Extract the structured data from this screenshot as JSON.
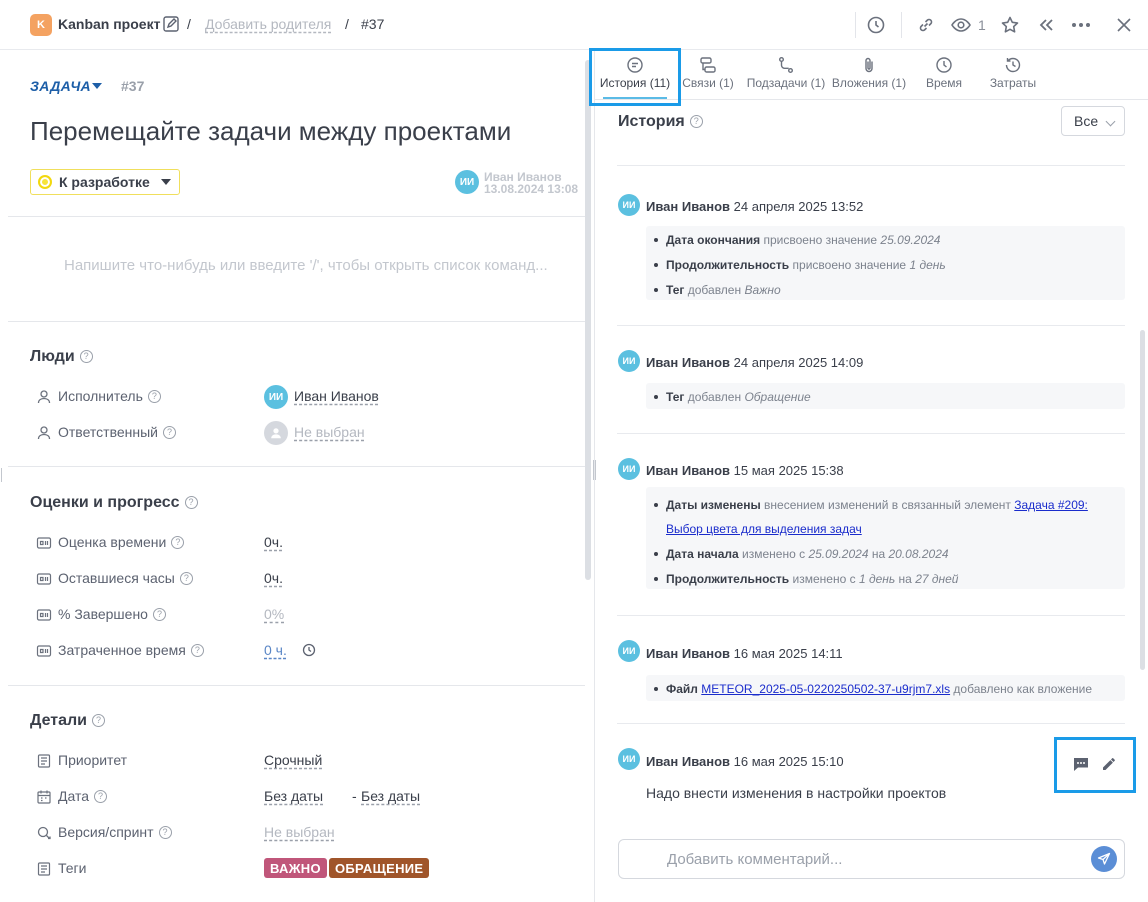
{
  "header": {
    "project_initial": "K",
    "project_name": "Kanban проект",
    "separator": "/",
    "add_parent": "Добавить родителя",
    "task_number": "#37",
    "watchers_count": "1"
  },
  "task": {
    "type": "ЗАДАЧА",
    "number": "#37",
    "title": "Перемещайте задачи между проектами",
    "status": "К разработке",
    "author_initials": "ИИ",
    "author_name": "Иван Иванов",
    "author_date": "13.08.2024 13:08",
    "description_placeholder": "Напишите что-нибудь или введите '/', чтобы открыть список команд..."
  },
  "people": {
    "title": "Люди",
    "assignee_label": "Исполнитель",
    "assignee_initials": "ИИ",
    "assignee_value": "Иван Иванов",
    "responsible_label": "Ответственный",
    "responsible_value": "Не выбран"
  },
  "estimates": {
    "title": "Оценки и прогресс",
    "rows": [
      {
        "label": "Оценка времени",
        "value": "0ч."
      },
      {
        "label": "Оставшиеся часы",
        "value": "0ч."
      },
      {
        "label": "% Завершено",
        "value": "0%"
      },
      {
        "label": "Затраченное время",
        "value": "0 ч."
      }
    ]
  },
  "details": {
    "title": "Детали",
    "priority_label": "Приоритет",
    "priority_value": "Срочный",
    "date_label": "Дата",
    "date_start": "Без даты",
    "date_sep": "-",
    "date_end": "Без даты",
    "version_label": "Версия/спринт",
    "version_value": "Не выбран",
    "tags_label": "Теги",
    "tags": [
      {
        "label": "ВАЖНО",
        "color": "#c0567a"
      },
      {
        "label": "ОБРАЩЕНИЕ",
        "color": "#a0552a"
      }
    ]
  },
  "tabs": [
    {
      "label": "История (11)",
      "icon": "comment-icon"
    },
    {
      "label": "Связи (1)",
      "icon": "links-icon"
    },
    {
      "label": "Подзадачи (1)",
      "icon": "subtasks-icon"
    },
    {
      "label": "Вложения (1)",
      "icon": "paperclip-icon"
    },
    {
      "label": "Время",
      "icon": "clock-icon"
    },
    {
      "label": "Затраты",
      "icon": "costs-icon"
    }
  ],
  "history": {
    "title": "История",
    "filter": "Все",
    "entries": [
      {
        "initials": "ИИ",
        "author": "Иван Иванов",
        "date": "24 апреля 2025 13:52",
        "changes": [
          {
            "field": "Дата окончания",
            "action": "присвоено значение",
            "value": "25.09.2024"
          },
          {
            "field": "Продолжительность",
            "action": "присвоено значение",
            "value": "1 день"
          },
          {
            "field": "Тег",
            "action": "добавлен",
            "value": "Важно"
          }
        ]
      },
      {
        "initials": "ИИ",
        "author": "Иван Иванов",
        "date": "24 апреля 2025 14:09",
        "changes": [
          {
            "field": "Тег",
            "action": "добавлен",
            "value": "Обращение"
          }
        ]
      },
      {
        "initials": "ИИ",
        "author": "Иван Иванов",
        "date": "15 мая 2025 15:38",
        "changes": [
          {
            "field": "Даты изменены",
            "action": "внесением изменений в связанный элемент",
            "link1": "Задача #209:",
            "link2": "Выбор цвета для выделения задач"
          },
          {
            "field": "Дата начала",
            "action": "изменено с",
            "from": "25.09.2024",
            "to_word": "на",
            "to": "20.08.2024"
          },
          {
            "field": "Продолжительность",
            "action": "изменено с",
            "from": "1 день",
            "to_word": "на",
            "to": "27 дней"
          }
        ]
      },
      {
        "initials": "ИИ",
        "author": "Иван Иванов",
        "date": "16 мая 2025 14:11",
        "changes": [
          {
            "field": "Файл",
            "link": "METEOR_2025-05-0220250502-37-u9rjm7.xls",
            "action": "добавлено как вложение"
          }
        ]
      },
      {
        "initials": "ИИ",
        "author": "Иван Иванов",
        "date": "16 мая 2025 15:10",
        "comment": "Надо внести изменения в настройки проектов"
      }
    ]
  },
  "comment_input": {
    "placeholder": "Добавить комментарий..."
  },
  "colors": {
    "accent": "#1e5fa8",
    "avatar": "#5bc0e0",
    "highlight": "#1a9be8",
    "send": "#5b8ed6"
  }
}
